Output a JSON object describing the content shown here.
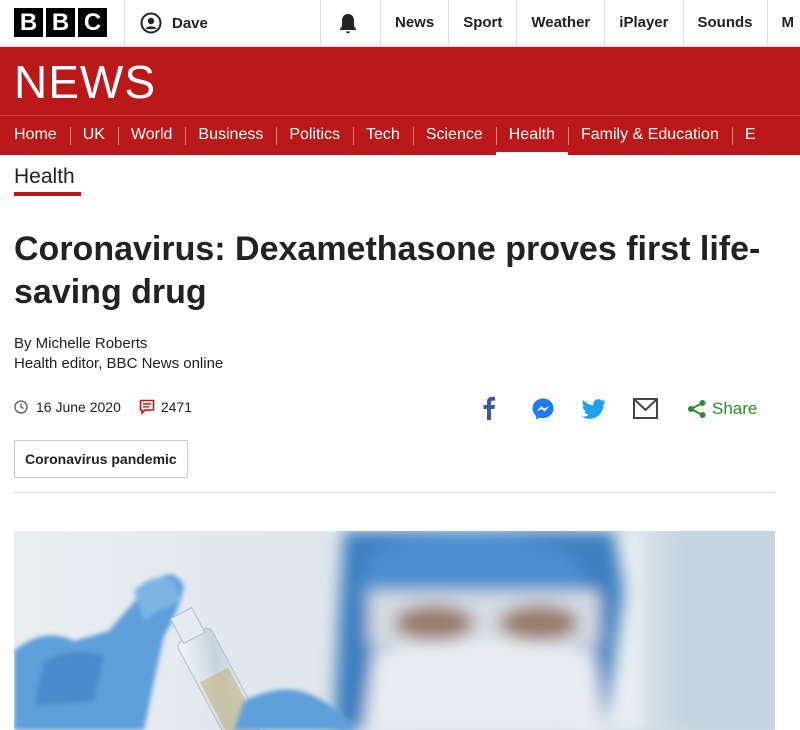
{
  "brand": {
    "letters": [
      "B",
      "B",
      "C"
    ]
  },
  "account": {
    "name": "Dave"
  },
  "top_links": [
    "News",
    "Sport",
    "Weather",
    "iPlayer",
    "Sounds",
    "M"
  ],
  "banner": {
    "title": "NEWS"
  },
  "nav": {
    "items": [
      "Home",
      "UK",
      "World",
      "Business",
      "Politics",
      "Tech",
      "Science",
      "Health",
      "Family & Education",
      "E"
    ],
    "active": "Health"
  },
  "section": {
    "label": "Health"
  },
  "article": {
    "headline": "Coronavirus: Dexamethasone proves first life-saving drug",
    "author": "By Michelle Roberts",
    "author_role": "Health editor, BBC News online",
    "date": "16 June 2020",
    "comment_count": "2471",
    "share_label": "Share",
    "tag": "Coronavirus pandemic"
  },
  "share_icons": [
    "facebook-icon",
    "messenger-icon",
    "twitter-icon",
    "email-icon",
    "share-icon"
  ],
  "colors": {
    "brand_red": "#bb1919",
    "facebook": "#3b5998",
    "messenger": "#1f7bf2",
    "twitter": "#1da1f2",
    "share_green": "#2e8b2e"
  }
}
